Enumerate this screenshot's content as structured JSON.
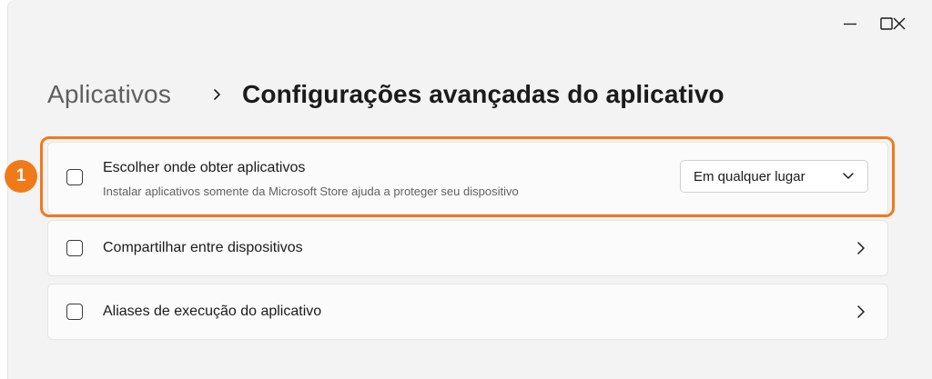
{
  "window": {
    "minimize_icon": "minimize-icon",
    "maximize_icon": "maximize-icon",
    "close_icon": "close-icon"
  },
  "breadcrumb": {
    "parent": "Aplicativos",
    "separator_icon": "chevron-right-icon",
    "current": "Configurações avançadas do aplicativo"
  },
  "annotation": {
    "badge": "1",
    "color": "#f07a1a"
  },
  "settings": [
    {
      "title": "Escolher onde obter aplicativos",
      "subtitle": "Instalar aplicativos somente da Microsoft Store ajuda a proteger seu dispositivo",
      "control": "dropdown",
      "dropdown_value": "Em qualquer lugar"
    },
    {
      "title": "Compartilhar entre dispositivos",
      "control": "chevron"
    },
    {
      "title": "Aliases de execução do aplicativo",
      "control": "chevron"
    }
  ]
}
